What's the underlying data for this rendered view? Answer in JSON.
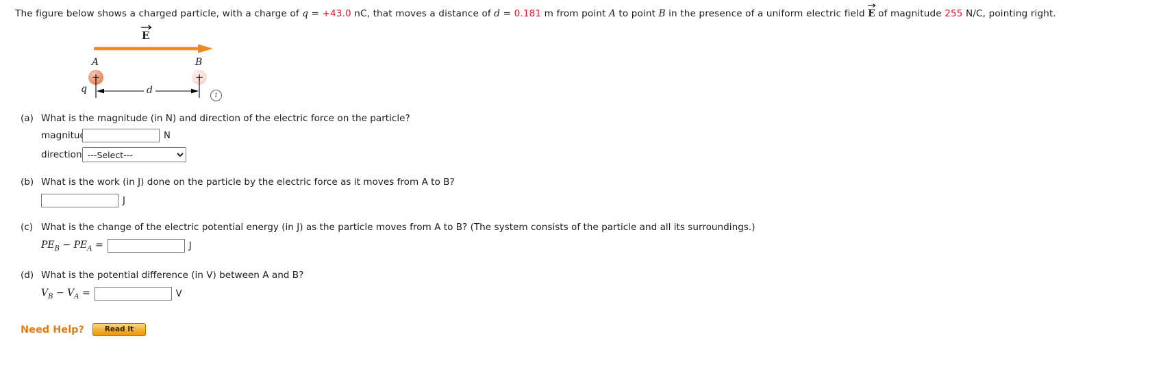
{
  "problem": {
    "intro_segments": [
      {
        "t": "The figure below shows a charged particle, with a charge of ",
        "k": "plain"
      },
      {
        "t": "q",
        "k": "var"
      },
      {
        "t": " = ",
        "k": "plain"
      },
      {
        "t": "+43.0",
        "k": "val"
      },
      {
        "t": " nC, that moves a distance of ",
        "k": "plain"
      },
      {
        "t": "d",
        "k": "var"
      },
      {
        "t": " = ",
        "k": "plain"
      },
      {
        "t": "0.181",
        "k": "val"
      },
      {
        "t": " m from point ",
        "k": "plain"
      },
      {
        "t": "A",
        "k": "var"
      },
      {
        "t": " to point ",
        "k": "plain"
      },
      {
        "t": "B",
        "k": "var"
      },
      {
        "t": " in the presence of a uniform electric field ",
        "k": "plain"
      },
      {
        "t": "E",
        "k": "vec"
      },
      {
        "t": " of magnitude ",
        "k": "plain"
      },
      {
        "t": "255",
        "k": "val"
      },
      {
        "t": " N/C, pointing right.",
        "k": "plain"
      }
    ],
    "charge_value": "+43.0",
    "charge_unit": "nC",
    "distance_value": "0.181",
    "distance_unit": "m",
    "field_value": "255",
    "field_unit": "N/C",
    "field_direction": "right"
  },
  "figure": {
    "field_label": "E",
    "point_a_label": "A",
    "point_b_label": "B",
    "charge_label": "q",
    "distance_label": "d",
    "charge_sign": "+",
    "info_icon_label": "i",
    "arrow_color": "#ef8a22",
    "charge_a_color": "#ef9b7c",
    "charge_b_color": "#fbdfd4"
  },
  "parts": {
    "a": {
      "tag": "(a)",
      "question": "What is the magnitude (in N) and direction of the electric force on the particle?",
      "magnitude_label": "magnitude",
      "magnitude_value": "",
      "magnitude_unit": "N",
      "direction_label": "direction",
      "direction_selected": "---Select---",
      "direction_options": [
        "---Select---"
      ]
    },
    "b": {
      "tag": "(b)",
      "question": "What is the work (in J) done on the particle by the electric force as it moves from A to B?",
      "value": "",
      "unit": "J"
    },
    "c": {
      "tag": "(c)",
      "question": "What is the change of the electric potential energy (in J) as the particle moves from A to B? (The system consists of the particle and all its surroundings.)",
      "expression_lhs": "PE",
      "expression_sub_1": "B",
      "expression_minus": "−",
      "expression_sub_2": "A",
      "expression_equals": "=",
      "value": "",
      "unit": "J"
    },
    "d": {
      "tag": "(d)",
      "question": "What is the potential difference (in V) between A and B?",
      "expression_lhs": "V",
      "expression_sub_1": "B",
      "expression_minus": "−",
      "expression_sub_2": "A",
      "expression_equals": "=",
      "value": "",
      "unit": "V"
    }
  },
  "help": {
    "label": "Need Help?",
    "button_label": "Read It",
    "accent_color": "#e87b10"
  }
}
